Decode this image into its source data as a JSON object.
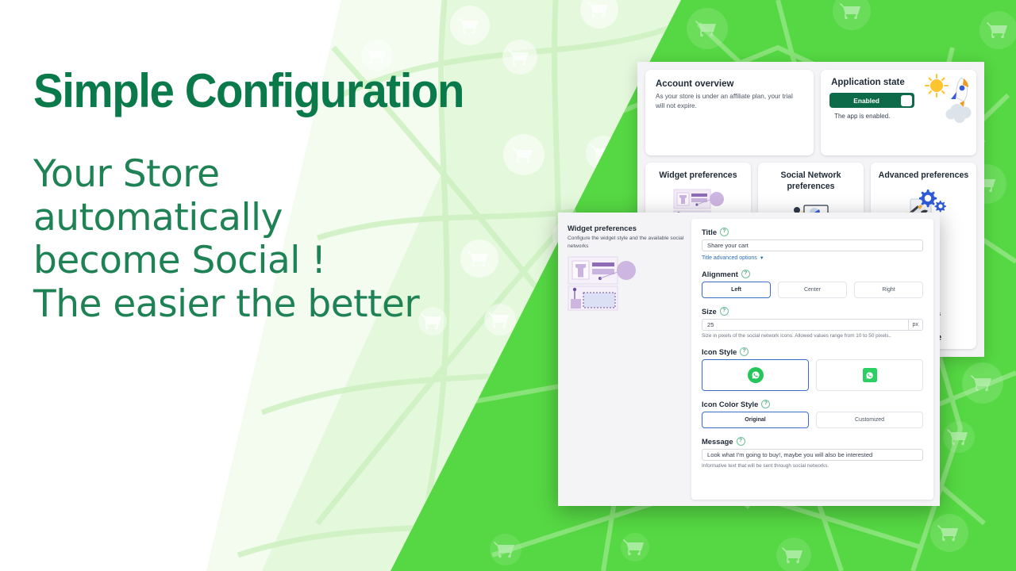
{
  "hero": {
    "headline": "Simple Configuration",
    "sub_lines": [
      "Your Store",
      "automatically",
      "become Social !",
      "The easier the  better"
    ],
    "headline_color": "#0B7A4B",
    "sub_color": "#1E8255"
  },
  "background": {
    "bright_green": "#55D843",
    "pale_green": "#E4F8DC",
    "white": "#FFFFFF",
    "motif": "shopping-cart-network"
  },
  "dashboard": {
    "account_overview": {
      "title": "Account overview",
      "description": "As your store is under an affiliate plan, your trial will not expire."
    },
    "application_state": {
      "title": "Application state",
      "toggle_label": "Enabled",
      "toggle_color": "#0E6B4A",
      "note": "The app is enabled.",
      "illustration": "rocket-sun-icon"
    },
    "preference_cards": [
      {
        "title": "Widget preferences",
        "illustration": "widget-layout-icon",
        "body": "",
        "badge": ""
      },
      {
        "title": "Social Network preferences",
        "illustration": "person-laptop-icon",
        "body": "",
        "badge": ""
      },
      {
        "title": "Advanced preferences",
        "illustration": "gear-tools-icon",
        "body": "nd other ions",
        "badge": "& Share"
      }
    ]
  },
  "widget_modal": {
    "sidebar": {
      "title": "Widget preferences",
      "description": "Configure the widget style and the available social networks",
      "thumbnail": "widget-layout-thumbnail"
    },
    "fields": {
      "title": {
        "label": "Title",
        "value": "Share your cart",
        "advanced_link": "Title advanced options"
      },
      "alignment": {
        "label": "Alignment",
        "options": [
          "Left",
          "Center",
          "Right"
        ],
        "selected": "Left"
      },
      "size": {
        "label": "Size",
        "value": "25",
        "unit": "px",
        "hint": "Size in pixels of the social network icons. Allowed values range from 10 to 50 pixels.."
      },
      "icon_style": {
        "label": "Icon Style",
        "options": [
          "round-whatsapp-icon",
          "square-whatsapp-icon"
        ],
        "selected_index": 0
      },
      "icon_color_style": {
        "label": "Icon Color Style",
        "options": [
          "Original",
          "Customized"
        ],
        "selected": "Original"
      },
      "message": {
        "label": "Message",
        "value": "Look what I'm going to buy!, maybe you will also be interested",
        "hint": "Informative text that will be sent through social networks."
      }
    },
    "accent_selected": "#3A6FC4",
    "link_color": "#2B6CB0"
  }
}
